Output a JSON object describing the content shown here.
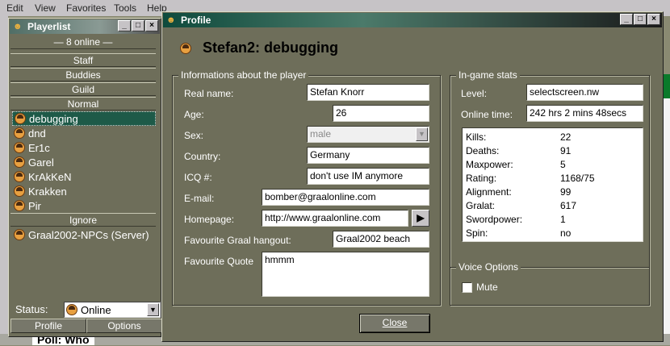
{
  "background": {
    "menu": [
      "Edit",
      "View",
      "Favorites",
      "Tools",
      "Help"
    ],
    "poll_text": "Poll: Who"
  },
  "playerlist": {
    "title": "Playerlist",
    "online_count": "8 online",
    "sections": {
      "staff": "Staff",
      "buddies": "Buddies",
      "guild": "Guild",
      "normal": "Normal",
      "ignore": "Ignore"
    },
    "normal_players": [
      "debugging",
      "dnd",
      "Er1c",
      "Garel",
      "KrAkKeN",
      "Krakken",
      "Pir"
    ],
    "ignore_players": [
      "Graal2002-NPCs (Server)"
    ],
    "status_label": "Status:",
    "status_value": "Online",
    "profile_button": "Profile",
    "options_button": "Options"
  },
  "profile": {
    "title": "Profile",
    "heading": "Stefan2: debugging",
    "info_group": "Informations about the player",
    "fields": {
      "real_name": {
        "label": "Real name:",
        "value": "Stefan Knorr"
      },
      "age": {
        "label": "Age:",
        "value": "26"
      },
      "sex": {
        "label": "Sex:",
        "value": "male"
      },
      "country": {
        "label": "Country:",
        "value": "Germany"
      },
      "icq": {
        "label": "ICQ #:",
        "value": "don't use IM anymore"
      },
      "email": {
        "label": "E-mail:",
        "value": "bomber@graalonline.com"
      },
      "homepage": {
        "label": "Homepage:",
        "value": "http://www.graalonline.com"
      },
      "hangout": {
        "label": "Favourite Graal hangout:",
        "value": "Graal2002 beach"
      },
      "quote": {
        "label": "Favourite Quote",
        "value": "hmmm"
      }
    },
    "ingame_group": "In-game stats",
    "level": {
      "label": "Level:",
      "value": "selectscreen.nw"
    },
    "online_time": {
      "label": "Online time:",
      "value": "242 hrs 2 mins 48secs"
    },
    "stats": [
      {
        "name": "Kills:",
        "value": "22"
      },
      {
        "name": "Deaths:",
        "value": "91"
      },
      {
        "name": "Maxpower:",
        "value": "5"
      },
      {
        "name": "Rating:",
        "value": "1168/75"
      },
      {
        "name": "Alignment:",
        "value": "99"
      },
      {
        "name": "Gralat:",
        "value": "617"
      },
      {
        "name": "Swordpower:",
        "value": "1"
      },
      {
        "name": "Spin:",
        "value": "no"
      }
    ],
    "voice_group": "Voice Options",
    "mute_label": "Mute",
    "mute_checked": false,
    "close_button": "Close"
  },
  "colors": {
    "window_bg": "#6e6e5a",
    "titlebar_active": "#0e4a3c",
    "selection": "#1e5a48"
  }
}
